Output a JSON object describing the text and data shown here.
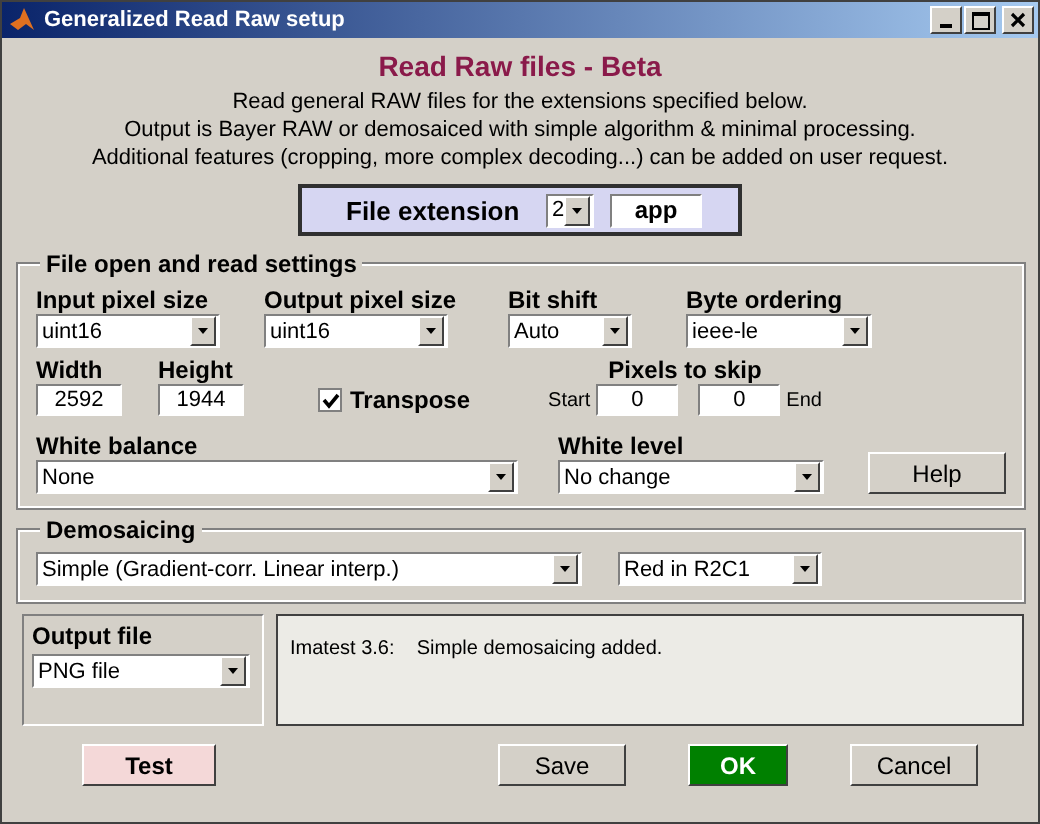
{
  "window": {
    "title": "Generalized Read Raw setup"
  },
  "heading": "Read Raw files -  Beta",
  "description": [
    "Read general RAW files for the extensions specified below.",
    "Output is Bayer RAW or demosaiced with simple algorithm & minimal processing.",
    "Additional features (cropping, more complex decoding...) can be added on user request."
  ],
  "file_extension": {
    "label": "File extension",
    "index": "2",
    "value": "app"
  },
  "file_settings": {
    "title": "File open and read settings",
    "dropdowns": [
      {
        "label": "Input pixel size",
        "value": "uint16"
      },
      {
        "label": "Output pixel size",
        "value": "uint16"
      },
      {
        "label": "Bit shift",
        "value": "Auto"
      },
      {
        "label": "Byte ordering",
        "value": "ieee-le"
      }
    ],
    "width": {
      "label": "Width",
      "value": "2592"
    },
    "height": {
      "label": "Height",
      "value": "1944"
    },
    "transpose": {
      "label": "Transpose",
      "checked": true
    },
    "pixels_to_skip": {
      "label": "Pixels to skip",
      "start_label": "Start",
      "start": "0",
      "end": "0",
      "end_label": "End"
    },
    "white_balance": {
      "label": "White balance",
      "value": "None"
    },
    "white_level": {
      "label": "White level",
      "value": "No change"
    },
    "help_button": "Help"
  },
  "demosaicing": {
    "title": "Demosaicing",
    "method": "Simple (Gradient-corr. Linear interp.)",
    "pattern": "Red in R2C1"
  },
  "output_file": {
    "title": "Output file",
    "value": "PNG file"
  },
  "notes": "Imatest 3.6:    Simple demosaicing added.",
  "buttons": [
    {
      "label": "Test",
      "color": "#f4d8d8"
    },
    {
      "label": "Save",
      "color": "#d4d0c8"
    },
    {
      "label": "OK",
      "color": "#008000"
    },
    {
      "label": "Cancel",
      "color": "#d4d0c8"
    }
  ]
}
